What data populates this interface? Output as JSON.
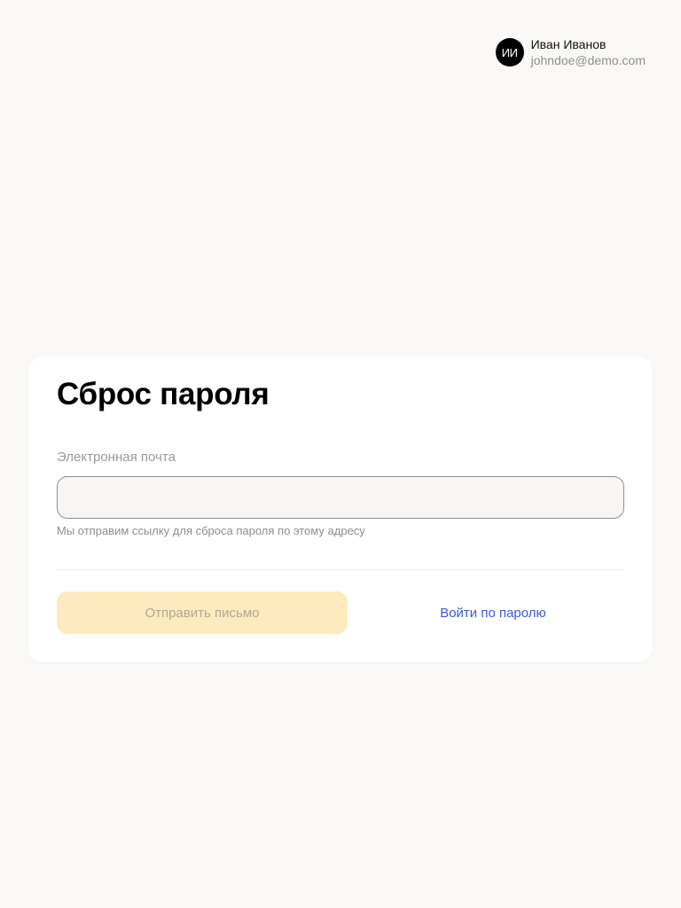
{
  "user": {
    "initials": "ИИ",
    "name": "Иван Иванов",
    "email": "johndoe@demo.com"
  },
  "form": {
    "title": "Сброс пароля",
    "email_label": "Электронная почта",
    "email_value": "",
    "email_hint": "Мы отправим ссылку для сброса пароля по этому адресу",
    "send_button_label": "Отправить письмо",
    "send_button_disabled": true,
    "password_login_link": "Войти по паролю"
  },
  "colors": {
    "background": "#faf9f7",
    "card": "#ffffff",
    "primary_button_disabled": "#fdebbf",
    "link": "#3d5ad8",
    "avatar": "#000000"
  }
}
